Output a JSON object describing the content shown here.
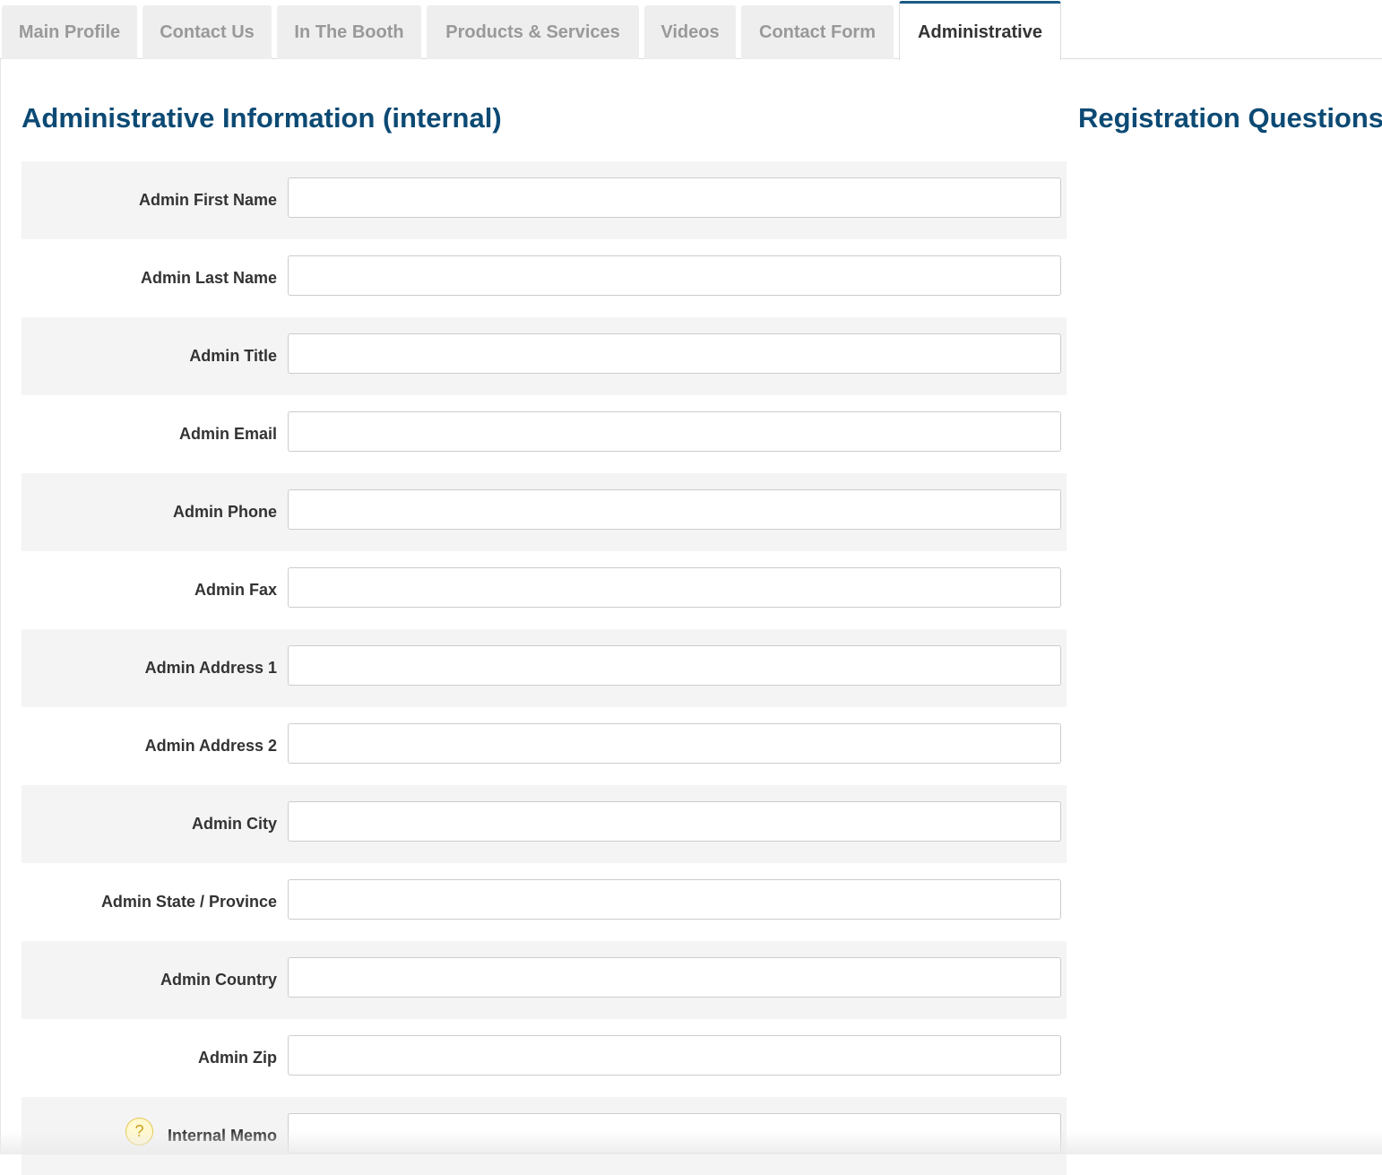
{
  "tabs": [
    {
      "label": "Main Profile",
      "active": false
    },
    {
      "label": "Contact Us",
      "active": false
    },
    {
      "label": "In The Booth",
      "active": false
    },
    {
      "label": "Products & Services",
      "active": false
    },
    {
      "label": "Videos",
      "active": false
    },
    {
      "label": "Contact Form",
      "active": false
    },
    {
      "label": "Administrative",
      "active": true
    }
  ],
  "main": {
    "title": "Administrative Information (internal)",
    "fields": [
      {
        "label": "Admin First Name",
        "value": ""
      },
      {
        "label": "Admin Last Name",
        "value": ""
      },
      {
        "label": "Admin Title",
        "value": ""
      },
      {
        "label": "Admin Email",
        "value": ""
      },
      {
        "label": "Admin Phone",
        "value": ""
      },
      {
        "label": "Admin Fax",
        "value": ""
      },
      {
        "label": "Admin Address 1",
        "value": ""
      },
      {
        "label": "Admin Address 2",
        "value": ""
      },
      {
        "label": "Admin City",
        "value": ""
      },
      {
        "label": "Admin State / Province",
        "value": ""
      },
      {
        "label": "Admin Country",
        "value": ""
      },
      {
        "label": "Admin Zip",
        "value": ""
      },
      {
        "label": "Internal Memo",
        "value": "",
        "help_icon": "question-mark-icon"
      }
    ]
  },
  "side": {
    "title": "Registration Questions"
  },
  "colors": {
    "heading": "#0c4a74",
    "active_tab_accent": "#1b5c87",
    "row_shade": "#f4f4f4"
  }
}
